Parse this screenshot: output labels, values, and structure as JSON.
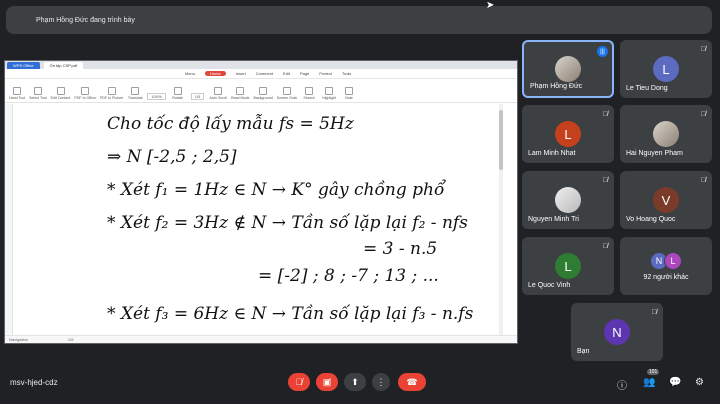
{
  "banner": {
    "presenter_text": "Phạm Hồng Đức đang trình bày"
  },
  "screen": {
    "tabs": [
      "WPS Office",
      "Ôn tập CSP.pdf"
    ],
    "menu": [
      "Menu",
      "Home",
      "Insert",
      "Comment",
      "Edit",
      "Page",
      "Protect",
      "Tools"
    ],
    "active_menu": "Home",
    "toolbar": [
      "Hand Tool",
      "Select Tool",
      "Edit Content",
      "PDF to Office",
      "PDF to Picture",
      "Translate",
      "Rotate",
      "Auto Scroll",
      "Read Mode",
      "Background",
      "Screen Grab",
      "Search",
      "Highlight",
      "Note"
    ],
    "zoom": "100%",
    "page_status": "1/5",
    "navigation_label": "Navigation",
    "lines": [
      "Cho tốc độ lấy mẫu fs = 5Hz",
      "⇒ N [-2,5 ; 2,5]",
      "* Xét f₁ = 1Hz ∈ N → K° gây chồng phổ",
      "* Xét f₂ = 3Hz ∉ N → Tần số lặp lại f₂ - nfs",
      "= 3 - n.5",
      "= [-2] ; 8 ; -7 ; 13 ; ...",
      "* Xét f₃ = 6Hz ∈ N → Tần số lặp lại f₃ - n.fs"
    ]
  },
  "participants": [
    {
      "name": "Phạm Hồng Đức",
      "initial": "",
      "color": "",
      "photo": true,
      "speaking": true
    },
    {
      "name": "Le Tieu Dong",
      "initial": "L",
      "color": "#5c6bc0",
      "photo": false,
      "speaking": false
    },
    {
      "name": "Lam Minh Nhat",
      "initial": "L",
      "color": "#c5411e",
      "photo": false,
      "speaking": false
    },
    {
      "name": "Hai Nguyen Pham",
      "initial": "",
      "color": "",
      "photo": true,
      "speaking": false
    },
    {
      "name": "Nguyen Minh Tri",
      "initial": "",
      "color": "",
      "photo": true,
      "speaking": false
    },
    {
      "name": "Vo Hoang Quoc",
      "initial": "V",
      "color": "#7b3b2a",
      "photo": false,
      "speaking": false
    },
    {
      "name": "Le Quoc Vinh",
      "initial": "L",
      "color": "#2e7d32",
      "photo": false,
      "speaking": false
    },
    {
      "name": "92 người khác",
      "initial": "",
      "color": "",
      "photo": false,
      "speaking": false
    },
    {
      "name": "Bạn",
      "initial": "N",
      "color": "#5e35b1",
      "photo": false,
      "speaking": false
    }
  ],
  "others_avatars": [
    {
      "initial": "N",
      "color": "#5c6bc0"
    },
    {
      "initial": "L",
      "color": "#ab47bc"
    }
  ],
  "bottom": {
    "meeting_code": "msv-hjed-cdz",
    "participant_count": "101"
  },
  "icons": {
    "mic_off": "mic-off-icon",
    "cam_off": "camera-off-icon",
    "present": "present-icon",
    "more": "more-vert-icon",
    "hangup": "hangup-icon",
    "info": "info-icon",
    "people": "people-icon",
    "chat": "chat-icon",
    "activities": "activities-icon"
  }
}
